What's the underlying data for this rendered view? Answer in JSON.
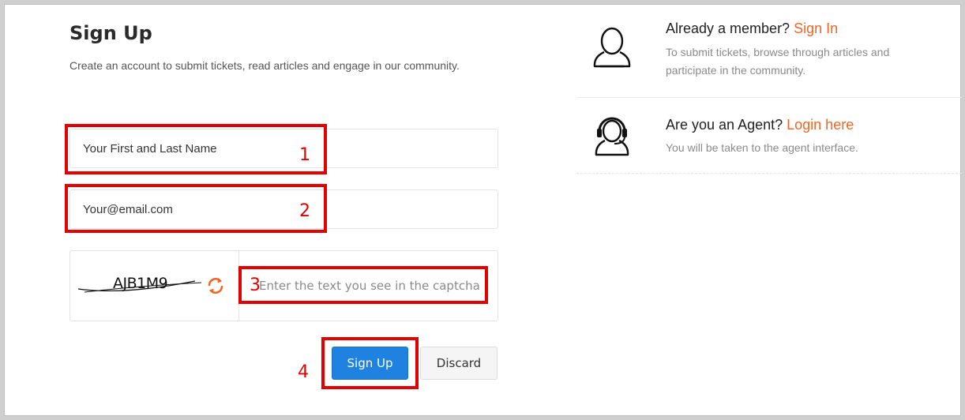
{
  "signup": {
    "title": "Sign Up",
    "subtitle": "Create an account to submit tickets, read articles and engage in our community.",
    "name_field": {
      "value": "Your First and Last Name"
    },
    "email_field": {
      "value": "Your@email.com"
    },
    "captcha": {
      "image_text": "AJB1M9",
      "input_placeholder": "Enter the text you see in the captcha"
    },
    "buttons": {
      "signup_label": "Sign Up",
      "discard_label": "Discard"
    }
  },
  "annotations": [
    "1",
    "2",
    "3",
    "4"
  ],
  "sidebar": {
    "member": {
      "heading": "Already a member?",
      "link": "Sign In",
      "description": "To submit tickets, browse through articles and participate in the community.",
      "icon": "user-icon"
    },
    "agent": {
      "heading": "Are you an Agent?",
      "link": "Login here",
      "description": "You will be taken to the agent interface.",
      "icon": "headset-agent-icon"
    }
  },
  "colors": {
    "accent_link": "#f26522",
    "primary_button": "#1f82e0",
    "annotation": "#e30000"
  }
}
